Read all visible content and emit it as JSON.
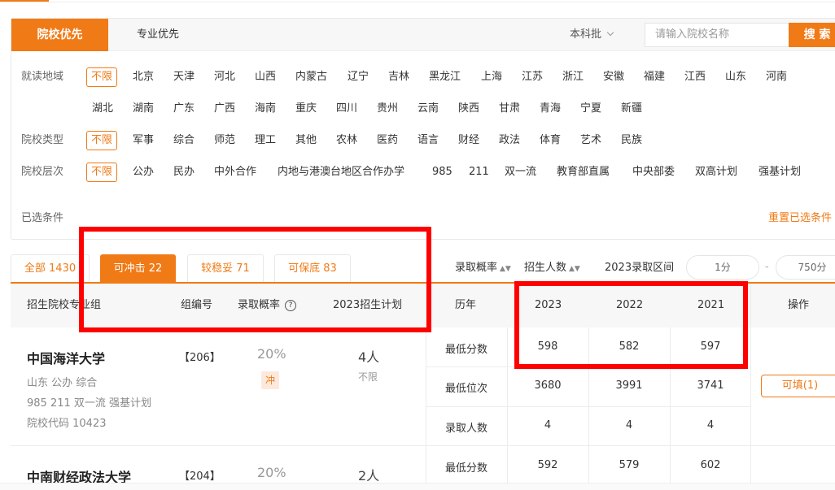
{
  "filters": {
    "tabs": [
      "院校优先",
      "专业优先"
    ],
    "batch": "本科批",
    "search_placeholder": "请输入院校名称",
    "search_button": "搜 索",
    "region_label": "就读地域",
    "region_row1": [
      "不限",
      "北京",
      "天津",
      "河北",
      "山西",
      "内蒙古",
      "辽宁",
      "吉林",
      "黑龙江",
      "上海",
      "江苏",
      "浙江",
      "安徽",
      "福建",
      "江西",
      "山东",
      "河南"
    ],
    "region_row2": [
      "湖北",
      "湖南",
      "广东",
      "广西",
      "海南",
      "重庆",
      "四川",
      "贵州",
      "云南",
      "陕西",
      "甘肃",
      "青海",
      "宁夏",
      "新疆"
    ],
    "type_label": "院校类型",
    "types": [
      "不限",
      "军事",
      "综合",
      "师范",
      "理工",
      "其他",
      "农林",
      "医药",
      "语言",
      "财经",
      "政法",
      "体育",
      "艺术",
      "民族"
    ],
    "level_label": "院校层次",
    "levels": [
      "不限",
      "公办",
      "民办",
      "中外合作",
      "内地与港澳台地区合作办学",
      "985",
      "211",
      "双一流",
      "教育部直属",
      "中央部委",
      "双高计划",
      "强基计划"
    ],
    "selected_label": "已选条件",
    "reset_label": "重置已选条件"
  },
  "result_tabs": [
    {
      "label": "全部 1430"
    },
    {
      "label": "可冲击 22"
    },
    {
      "label": "较稳妥 71"
    },
    {
      "label": "可保底 83"
    }
  ],
  "sort": {
    "prob": "录取概率",
    "count": "招生人数",
    "range_label": "2023录取区间",
    "range_min": "1分",
    "range_max": "750分"
  },
  "table": {
    "headers": {
      "group": "招生院校专业组",
      "code": "组编号",
      "prob": "录取概率",
      "plan": "2023招生计划",
      "history": "历年",
      "y2023": "2023",
      "y2022": "2022",
      "y2021": "2021",
      "action": "操作"
    },
    "rows": [
      {
        "name": "中国海洋大学",
        "meta1": "山东  公办  综合",
        "meta2": "985 211 双一流 强基计划",
        "meta3": "院校代码 10423",
        "code": "【206】",
        "prob": "20%",
        "tag": "冲",
        "plan": "4人",
        "plan_sub": "不限",
        "stats": [
          {
            "label": "最低分数",
            "values": [
              "598",
              "582",
              "597"
            ]
          },
          {
            "label": "最低位次",
            "values": [
              "3680",
              "3991",
              "3741"
            ]
          },
          {
            "label": "录取人数",
            "values": [
              "4",
              "4",
              "4"
            ]
          }
        ],
        "action": "可填(1)"
      },
      {
        "name": "中南财经政法大学",
        "code": "【204】",
        "prob": "20%",
        "plan": "2人",
        "stats": [
          {
            "label": "最低分数",
            "values": [
              "592",
              "579",
              "602"
            ]
          }
        ]
      }
    ]
  },
  "colors": {
    "accent": "#f07a16",
    "annotation": "#ff0000"
  }
}
